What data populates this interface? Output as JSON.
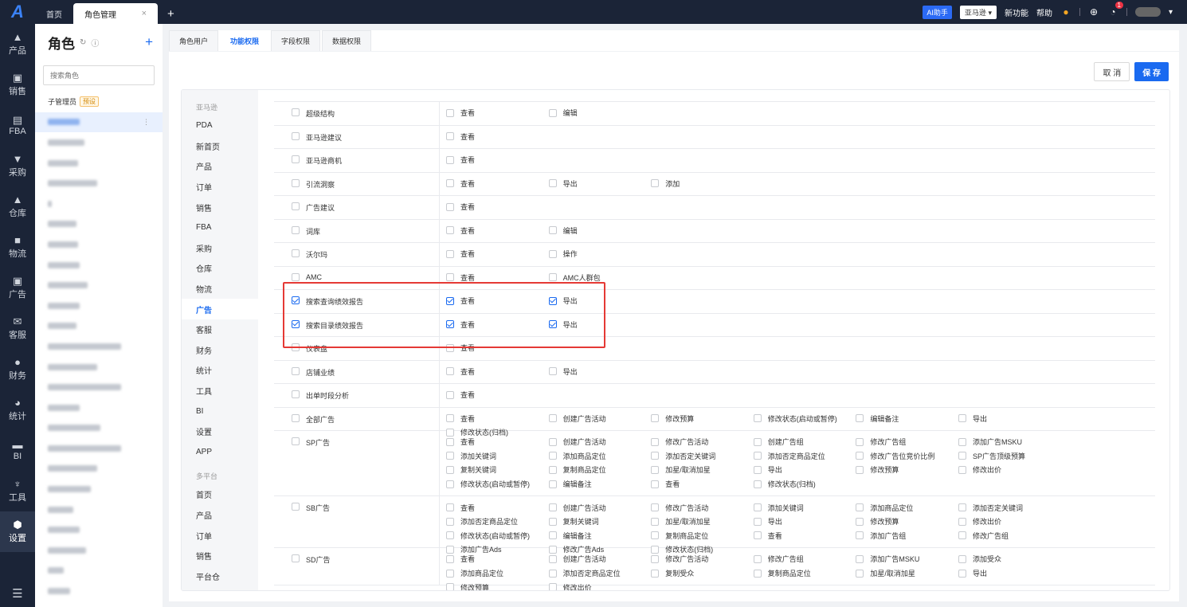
{
  "topbar": {
    "tabs": [
      {
        "label": "首页"
      },
      {
        "label": "角色管理"
      }
    ],
    "close_glyph": "×",
    "add_tab_glyph": "+",
    "ai_label": "AI助手",
    "account_label": "亚马逊",
    "new_features": "新功能",
    "help": "帮助",
    "notification_count": "1"
  },
  "nav": {
    "items": [
      "产品",
      "销售",
      "FBA",
      "采购",
      "仓库",
      "物流",
      "广告",
      "客服",
      "财务",
      "统计",
      "BI",
      "工具",
      "设置"
    ],
    "active": "设置"
  },
  "roles": {
    "title": "角色",
    "add_glyph": "+",
    "search_placeholder": "搜索角色",
    "first": {
      "name": "子管理员",
      "tag": "预设"
    },
    "more_glyph": "⋮"
  },
  "tabs": [
    "角色用户",
    "功能权限",
    "字段权限",
    "数据权限"
  ],
  "active_tab": "功能权限",
  "buttons": {
    "cancel": "取 消",
    "save": "保 存"
  },
  "categories": [
    {
      "group": "亚马逊",
      "items": [
        "PDA",
        "新首页",
        "产品",
        "订单",
        "销售",
        "FBA",
        "采购",
        "仓库",
        "物流",
        "广告",
        "客服",
        "财务",
        "统计",
        "工具",
        "BI",
        "设置",
        "APP"
      ]
    },
    {
      "group": "多平台",
      "items": [
        "首页",
        "产品",
        "订单",
        "销售",
        "平台仓"
      ]
    }
  ],
  "active_category": "广告",
  "permissions": [
    {
      "module": "超级结构",
      "checked": false,
      "actions": [
        {
          "label": "查看",
          "checked": false
        },
        {
          "label": "编辑",
          "checked": false
        }
      ]
    },
    {
      "module": "亚马逊建议",
      "checked": false,
      "actions": [
        {
          "label": "查看",
          "checked": false
        }
      ]
    },
    {
      "module": "亚马逊商机",
      "checked": false,
      "actions": [
        {
          "label": "查看",
          "checked": false
        }
      ]
    },
    {
      "module": "引流洞察",
      "checked": false,
      "actions": [
        {
          "label": "查看",
          "checked": false
        },
        {
          "label": "导出",
          "checked": false
        },
        {
          "label": "添加",
          "checked": false
        }
      ]
    },
    {
      "module": "广告建议",
      "checked": false,
      "actions": [
        {
          "label": "查看",
          "checked": false
        }
      ]
    },
    {
      "module": "词库",
      "checked": false,
      "actions": [
        {
          "label": "查看",
          "checked": false
        },
        {
          "label": "编辑",
          "checked": false
        }
      ]
    },
    {
      "module": "沃尔玛",
      "checked": false,
      "actions": [
        {
          "label": "查看",
          "checked": false
        },
        {
          "label": "操作",
          "checked": false
        }
      ]
    },
    {
      "module": "AMC",
      "checked": false,
      "actions": [
        {
          "label": "查看",
          "checked": false
        },
        {
          "label": "AMC人群包",
          "checked": false
        }
      ]
    },
    {
      "module": "搜索查询绩效报告",
      "checked": true,
      "actions": [
        {
          "label": "查看",
          "checked": true
        },
        {
          "label": "导出",
          "checked": true
        }
      ]
    },
    {
      "module": "搜索目录绩效报告",
      "checked": true,
      "actions": [
        {
          "label": "查看",
          "checked": true
        },
        {
          "label": "导出",
          "checked": true
        }
      ]
    },
    {
      "module": "仪表盘",
      "checked": false,
      "actions": [
        {
          "label": "查看",
          "checked": false
        }
      ]
    },
    {
      "module": "店铺业绩",
      "checked": false,
      "actions": [
        {
          "label": "查看",
          "checked": false
        },
        {
          "label": "导出",
          "checked": false
        }
      ]
    },
    {
      "module": "出单时段分析",
      "checked": false,
      "actions": [
        {
          "label": "查看",
          "checked": false
        }
      ]
    },
    {
      "module": "全部广告",
      "checked": false,
      "actions": [
        {
          "label": "查看",
          "checked": false
        },
        {
          "label": "创建广告活动",
          "checked": false
        },
        {
          "label": "修改预算",
          "checked": false
        },
        {
          "label": "修改状态(启动或暂停)",
          "checked": false
        },
        {
          "label": "编辑备注",
          "checked": false
        },
        {
          "label": "导出",
          "checked": false
        },
        {
          "label": "修改状态(归档)",
          "checked": false
        }
      ]
    },
    {
      "module": "SP广告",
      "checked": false,
      "actions": [
        {
          "label": "查看",
          "checked": false
        },
        {
          "label": "创建广告活动",
          "checked": false
        },
        {
          "label": "修改广告活动",
          "checked": false
        },
        {
          "label": "创建广告组",
          "checked": false
        },
        {
          "label": "修改广告组",
          "checked": false
        },
        {
          "label": "添加广告MSKU",
          "checked": false
        },
        {
          "label": "添加关键词",
          "checked": false
        },
        {
          "label": "添加商品定位",
          "checked": false
        },
        {
          "label": "添加否定关键词",
          "checked": false
        },
        {
          "label": "添加否定商品定位",
          "checked": false
        },
        {
          "label": "修改广告位竞价比例",
          "checked": false
        },
        {
          "label": "SP广告顶级预算",
          "checked": false
        },
        {
          "label": "复制关键词",
          "checked": false
        },
        {
          "label": "复制商品定位",
          "checked": false
        },
        {
          "label": "加星/取消加星",
          "checked": false
        },
        {
          "label": "导出",
          "checked": false
        },
        {
          "label": "修改预算",
          "checked": false
        },
        {
          "label": "修改出价",
          "checked": false
        },
        {
          "label": "修改状态(启动或暂停)",
          "checked": false
        },
        {
          "label": "编辑备注",
          "checked": false
        },
        {
          "label": "查看",
          "checked": false
        },
        {
          "label": "修改状态(归档)",
          "checked": false
        }
      ]
    },
    {
      "module": "SB广告",
      "checked": false,
      "actions": [
        {
          "label": "查看",
          "checked": false
        },
        {
          "label": "创建广告活动",
          "checked": false
        },
        {
          "label": "修改广告活动",
          "checked": false
        },
        {
          "label": "添加关键词",
          "checked": false
        },
        {
          "label": "添加商品定位",
          "checked": false
        },
        {
          "label": "添加否定关键词",
          "checked": false
        },
        {
          "label": "添加否定商品定位",
          "checked": false
        },
        {
          "label": "复制关键词",
          "checked": false
        },
        {
          "label": "加星/取消加星",
          "checked": false
        },
        {
          "label": "导出",
          "checked": false
        },
        {
          "label": "修改预算",
          "checked": false
        },
        {
          "label": "修改出价",
          "checked": false
        },
        {
          "label": "修改状态(启动或暂停)",
          "checked": false
        },
        {
          "label": "编辑备注",
          "checked": false
        },
        {
          "label": "复制商品定位",
          "checked": false
        },
        {
          "label": "查看",
          "checked": false
        },
        {
          "label": "添加广告组",
          "checked": false
        },
        {
          "label": "修改广告组",
          "checked": false
        },
        {
          "label": "添加广告Ads",
          "checked": false
        },
        {
          "label": "修改广告Ads",
          "checked": false
        },
        {
          "label": "修改状态(归档)",
          "checked": false
        }
      ]
    },
    {
      "module": "SD广告",
      "checked": false,
      "actions": [
        {
          "label": "查看",
          "checked": false
        },
        {
          "label": "创建广告活动",
          "checked": false
        },
        {
          "label": "修改广告活动",
          "checked": false
        },
        {
          "label": "修改广告组",
          "checked": false
        },
        {
          "label": "添加广告MSKU",
          "checked": false
        },
        {
          "label": "添加受众",
          "checked": false
        },
        {
          "label": "添加商品定位",
          "checked": false
        },
        {
          "label": "添加否定商品定位",
          "checked": false
        },
        {
          "label": "复制受众",
          "checked": false
        },
        {
          "label": "复制商品定位",
          "checked": false
        },
        {
          "label": "加星/取消加星",
          "checked": false
        },
        {
          "label": "导出",
          "checked": false
        },
        {
          "label": "修改预算",
          "checked": false
        },
        {
          "label": "修改出价",
          "checked": false
        }
      ]
    }
  ]
}
